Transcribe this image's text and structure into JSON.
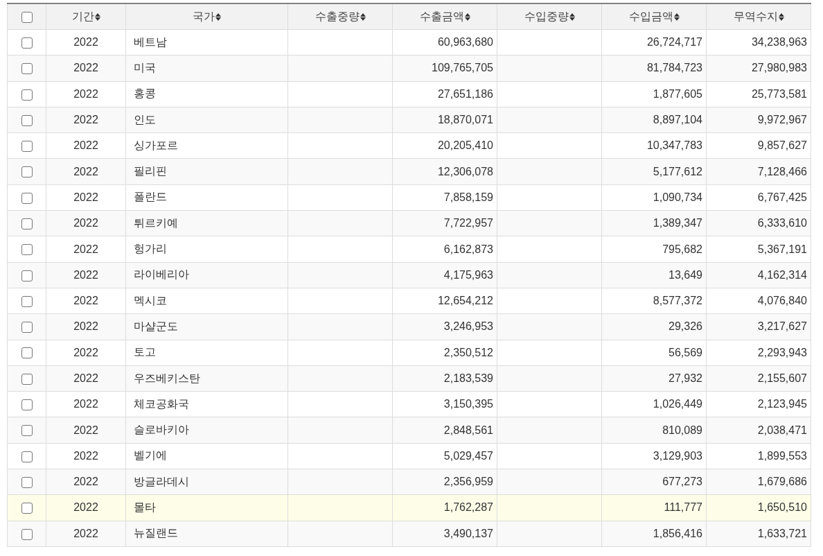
{
  "table": {
    "select_all": {
      "checked": false
    },
    "columns": [
      "기간",
      "국가",
      "수출중량",
      "수출금액",
      "수입중량",
      "수입금액",
      "무역수지"
    ],
    "rows": [
      {
        "checked": false,
        "highlighted": false,
        "period": "2022",
        "country": "베트남",
        "export_amount": "60,963,680",
        "import_amount": "26,724,717",
        "balance": "34,238,963"
      },
      {
        "checked": false,
        "highlighted": false,
        "period": "2022",
        "country": "미국",
        "export_amount": "109,765,705",
        "import_amount": "81,784,723",
        "balance": "27,980,983"
      },
      {
        "checked": false,
        "highlighted": false,
        "period": "2022",
        "country": "홍콩",
        "export_amount": "27,651,186",
        "import_amount": "1,877,605",
        "balance": "25,773,581"
      },
      {
        "checked": false,
        "highlighted": false,
        "period": "2022",
        "country": "인도",
        "export_amount": "18,870,071",
        "import_amount": "8,897,104",
        "balance": "9,972,967"
      },
      {
        "checked": false,
        "highlighted": false,
        "period": "2022",
        "country": "싱가포르",
        "export_amount": "20,205,410",
        "import_amount": "10,347,783",
        "balance": "9,857,627"
      },
      {
        "checked": false,
        "highlighted": false,
        "period": "2022",
        "country": "필리핀",
        "export_amount": "12,306,078",
        "import_amount": "5,177,612",
        "balance": "7,128,466"
      },
      {
        "checked": false,
        "highlighted": false,
        "period": "2022",
        "country": "폴란드",
        "export_amount": "7,858,159",
        "import_amount": "1,090,734",
        "balance": "6,767,425"
      },
      {
        "checked": false,
        "highlighted": false,
        "period": "2022",
        "country": "튀르키예",
        "export_amount": "7,722,957",
        "import_amount": "1,389,347",
        "balance": "6,333,610"
      },
      {
        "checked": false,
        "highlighted": false,
        "period": "2022",
        "country": "헝가리",
        "export_amount": "6,162,873",
        "import_amount": "795,682",
        "balance": "5,367,191"
      },
      {
        "checked": false,
        "highlighted": false,
        "period": "2022",
        "country": "라이베리아",
        "export_amount": "4,175,963",
        "import_amount": "13,649",
        "balance": "4,162,314"
      },
      {
        "checked": false,
        "highlighted": false,
        "period": "2022",
        "country": "멕시코",
        "export_amount": "12,654,212",
        "import_amount": "8,577,372",
        "balance": "4,076,840"
      },
      {
        "checked": false,
        "highlighted": false,
        "period": "2022",
        "country": "마샬군도",
        "export_amount": "3,246,953",
        "import_amount": "29,326",
        "balance": "3,217,627"
      },
      {
        "checked": false,
        "highlighted": false,
        "period": "2022",
        "country": "토고",
        "export_amount": "2,350,512",
        "import_amount": "56,569",
        "balance": "2,293,943"
      },
      {
        "checked": false,
        "highlighted": false,
        "period": "2022",
        "country": "우즈베키스탄",
        "export_amount": "2,183,539",
        "import_amount": "27,932",
        "balance": "2,155,607"
      },
      {
        "checked": false,
        "highlighted": false,
        "period": "2022",
        "country": "체코공화국",
        "export_amount": "3,150,395",
        "import_amount": "1,026,449",
        "balance": "2,123,945"
      },
      {
        "checked": false,
        "highlighted": false,
        "period": "2022",
        "country": "슬로바키아",
        "export_amount": "2,848,561",
        "import_amount": "810,089",
        "balance": "2,038,471"
      },
      {
        "checked": false,
        "highlighted": false,
        "period": "2022",
        "country": "벨기에",
        "export_amount": "5,029,457",
        "import_amount": "3,129,903",
        "balance": "1,899,553"
      },
      {
        "checked": false,
        "highlighted": false,
        "period": "2022",
        "country": "방글라데시",
        "export_amount": "2,356,959",
        "import_amount": "677,273",
        "balance": "1,679,686"
      },
      {
        "checked": false,
        "highlighted": true,
        "period": "2022",
        "country": "몰타",
        "export_amount": "1,762,287",
        "import_amount": "111,777",
        "balance": "1,650,510"
      },
      {
        "checked": false,
        "highlighted": false,
        "period": "2022",
        "country": "뉴질랜드",
        "export_amount": "3,490,137",
        "import_amount": "1,856,416",
        "balance": "1,633,721"
      }
    ]
  }
}
